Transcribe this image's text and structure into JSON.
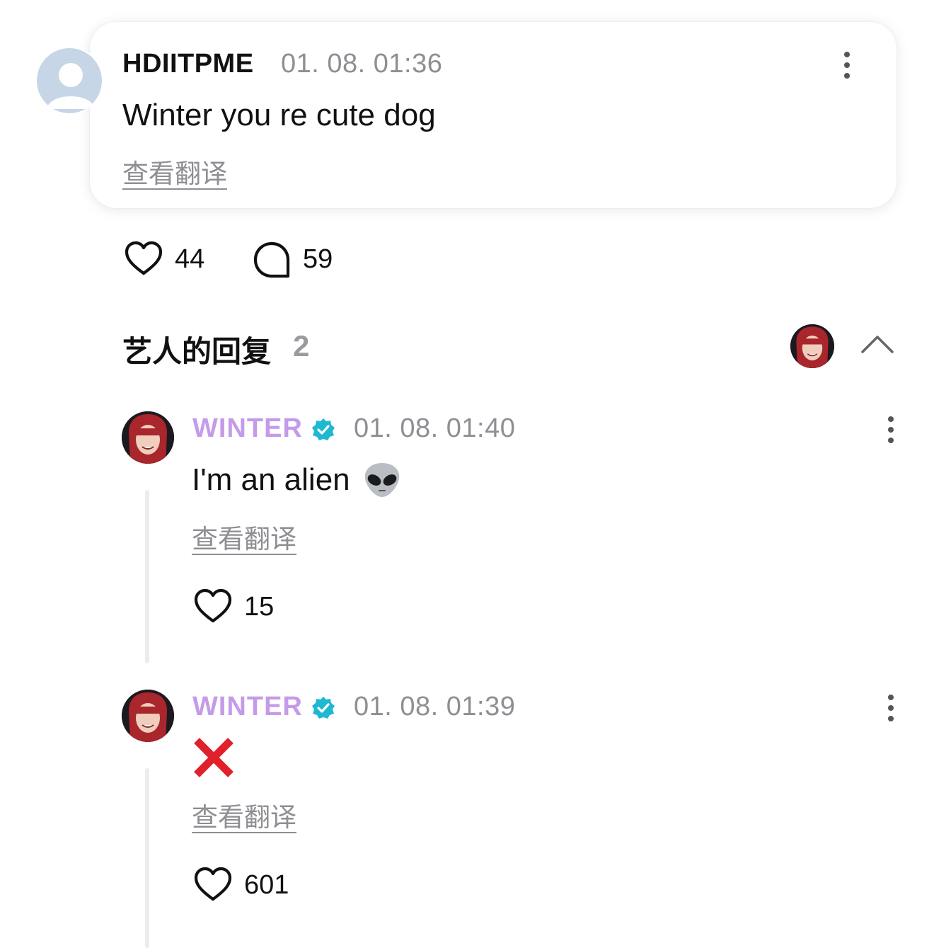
{
  "comment": {
    "username": "HDIITPME",
    "time": "01. 08. 01:36",
    "text": "Winter you re cute dog",
    "translate_label": "查看翻译",
    "likes": "44",
    "replies": "59"
  },
  "artist_replies": {
    "title": "艺人的回复",
    "count": "2",
    "items": [
      {
        "name": "WINTER",
        "time": "01. 08. 01:40",
        "text": "I'm an alien",
        "emoji": "alien-emoji",
        "translate_label": "查看翻译",
        "likes": "15"
      },
      {
        "name": "WINTER",
        "time": "01. 08. 01:39",
        "text": "",
        "emoji": "cross-mark-emoji",
        "translate_label": "查看翻译",
        "likes": "601"
      }
    ]
  },
  "colors": {
    "artist_name": "#c59be9",
    "verified_badge": "#1fb8d3",
    "muted": "#8e8e93",
    "cross": "#e0202a"
  }
}
